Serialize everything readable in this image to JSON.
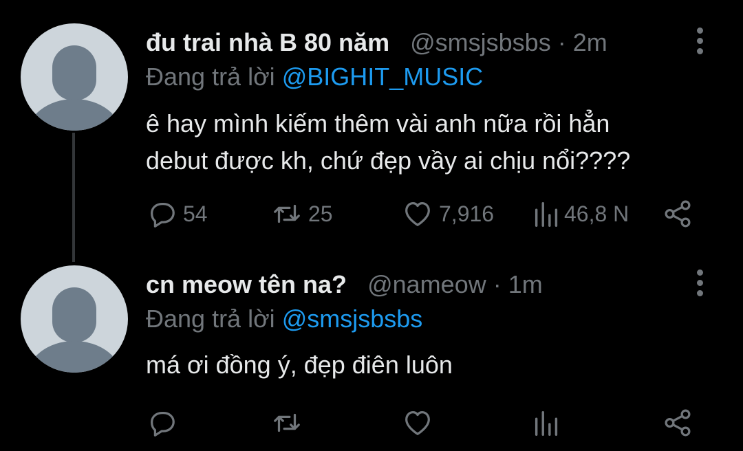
{
  "tweets": [
    {
      "name": "đu trai nhà B 80 năm",
      "handle": "@smsjsbsbs",
      "separator": "·",
      "time": "2m",
      "replying_prefix": "Đang trả lời",
      "replying_to": "@BIGHIT_MUSIC",
      "text_lines": [
        "ê hay mình kiếm thêm vài anh nữa rồi hẳn",
        "debut được kh, chứ đẹp vầy ai chịu nổi????"
      ],
      "actions": {
        "replies": "54",
        "retweets": "25",
        "likes": "7,916",
        "views": "46,8 N"
      }
    },
    {
      "name": "cn meow tên na?",
      "handle": "@nameow",
      "separator": "·",
      "time": "1m",
      "replying_prefix": "Đang trả lời",
      "replying_to": "@smsjsbsbs",
      "text_lines": [
        "má ơi đồng ý, đẹp điên luôn"
      ],
      "actions": {
        "replies": "",
        "retweets": "",
        "likes": "",
        "views": ""
      }
    }
  ],
  "colors": {
    "background": "#000000",
    "text": "#e7e9ea",
    "muted": "#71767b",
    "link": "#1d9bf0",
    "avatar_bg": "#cdd5db",
    "avatar_fg": "#6e7d8b"
  },
  "icons": [
    "reply-icon",
    "retweet-icon",
    "like-icon",
    "views-icon",
    "share-icon",
    "more-icon"
  ]
}
